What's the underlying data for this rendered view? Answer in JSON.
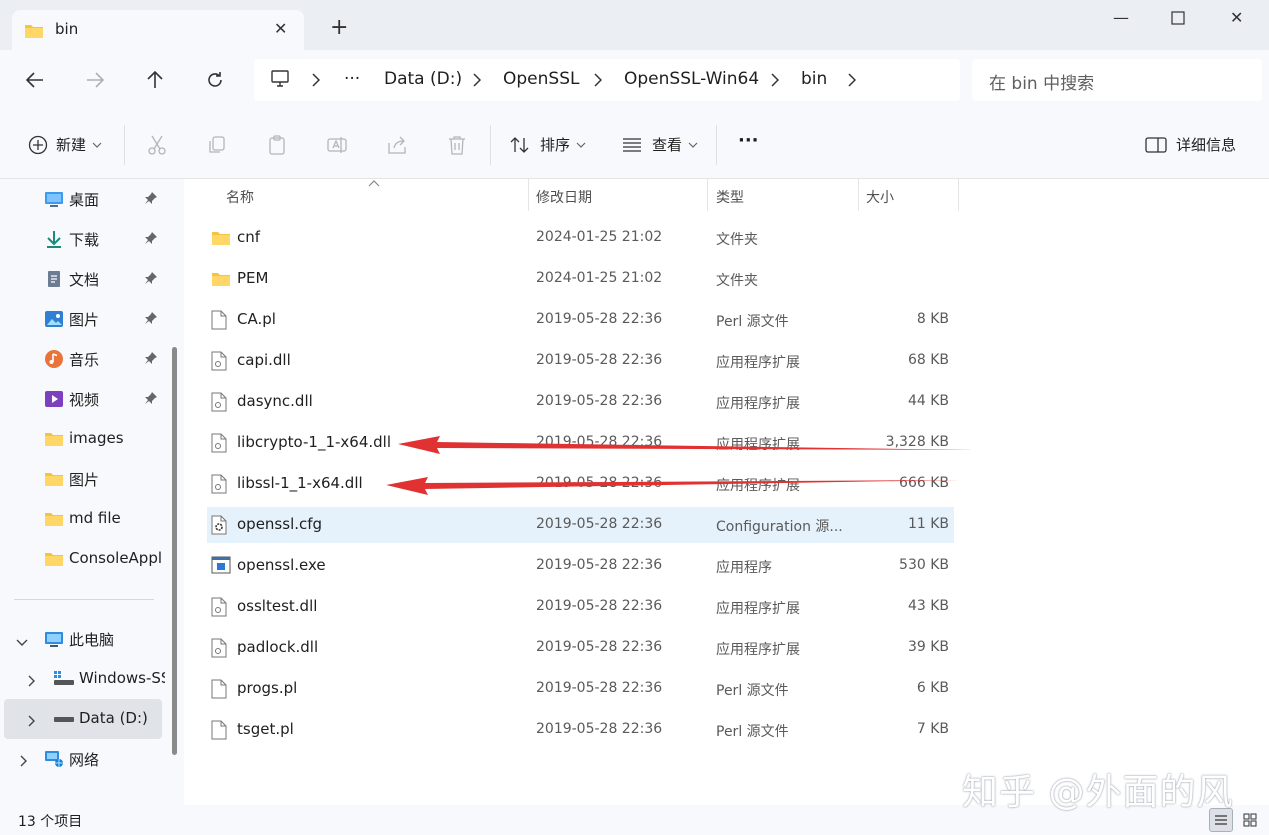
{
  "tab": {
    "title": "bin"
  },
  "breadcrumb": [
    "Data (D:)",
    "OpenSSL",
    "OpenSSL-Win64",
    "bin"
  ],
  "breadcrumb_overflow": "···",
  "search": {
    "placeholder": "在 bin 中搜索"
  },
  "toolbar": {
    "new_label": "新建",
    "sort_label": "排序",
    "view_label": "查看",
    "more_label": "···",
    "details_label": "详细信息"
  },
  "sidebar": {
    "quick_access": [
      {
        "label": "桌面",
        "icon": "desktop-icon"
      },
      {
        "label": "下载",
        "icon": "download-icon"
      },
      {
        "label": "文档",
        "icon": "document-icon"
      },
      {
        "label": "图片",
        "icon": "pictures-icon"
      },
      {
        "label": "音乐",
        "icon": "music-icon"
      },
      {
        "label": "视频",
        "icon": "video-icon"
      },
      {
        "label": "images",
        "icon": "folder-icon"
      },
      {
        "label": "图片",
        "icon": "folder-icon"
      },
      {
        "label": "md file",
        "icon": "folder-icon"
      },
      {
        "label": "ConsoleAppl",
        "icon": "folder-icon"
      }
    ],
    "tree": [
      {
        "label": "此电脑",
        "icon": "computer-icon"
      },
      {
        "label": "Windows-SSD",
        "icon": "drive-icon"
      },
      {
        "label": "Data (D:)",
        "icon": "drive-icon"
      },
      {
        "label": "网络",
        "icon": "network-icon"
      }
    ]
  },
  "columns": {
    "name": "名称",
    "date": "修改日期",
    "type": "类型",
    "size": "大小"
  },
  "files": [
    {
      "name": "cnf",
      "date": "2024-01-25 21:02",
      "type": "文件夹",
      "size": "",
      "icon": "folder-icon"
    },
    {
      "name": "PEM",
      "date": "2024-01-25 21:02",
      "type": "文件夹",
      "size": "",
      "icon": "folder-icon"
    },
    {
      "name": "CA.pl",
      "date": "2019-05-28 22:36",
      "type": "Perl 源文件",
      "size": "8 KB",
      "icon": "file-icon"
    },
    {
      "name": "capi.dll",
      "date": "2019-05-28 22:36",
      "type": "应用程序扩展",
      "size": "68 KB",
      "icon": "dll-icon"
    },
    {
      "name": "dasync.dll",
      "date": "2019-05-28 22:36",
      "type": "应用程序扩展",
      "size": "44 KB",
      "icon": "dll-icon"
    },
    {
      "name": "libcrypto-1_1-x64.dll",
      "date": "2019-05-28 22:36",
      "type": "应用程序扩展",
      "size": "3,328 KB",
      "icon": "dll-icon"
    },
    {
      "name": "libssl-1_1-x64.dll",
      "date": "2019-05-28 22:36",
      "type": "应用程序扩展",
      "size": "666 KB",
      "icon": "dll-icon"
    },
    {
      "name": "openssl.cfg",
      "date": "2019-05-28 22:36",
      "type": "Configuration 源...",
      "size": "11 KB",
      "icon": "config-icon"
    },
    {
      "name": "openssl.exe",
      "date": "2019-05-28 22:36",
      "type": "应用程序",
      "size": "530 KB",
      "icon": "exe-icon"
    },
    {
      "name": "ossltest.dll",
      "date": "2019-05-28 22:36",
      "type": "应用程序扩展",
      "size": "43 KB",
      "icon": "dll-icon"
    },
    {
      "name": "padlock.dll",
      "date": "2019-05-28 22:36",
      "type": "应用程序扩展",
      "size": "39 KB",
      "icon": "dll-icon"
    },
    {
      "name": "progs.pl",
      "date": "2019-05-28 22:36",
      "type": "Perl 源文件",
      "size": "6 KB",
      "icon": "file-icon"
    },
    {
      "name": "tsget.pl",
      "date": "2019-05-28 22:36",
      "type": "Perl 源文件",
      "size": "7 KB",
      "icon": "file-icon"
    }
  ],
  "status": {
    "count": "13 个项目"
  },
  "watermark": "知乎 @外面的风",
  "colors": {
    "selection": "#e5f1fb",
    "arrow": "#e03232",
    "folder": "#f5c342"
  }
}
